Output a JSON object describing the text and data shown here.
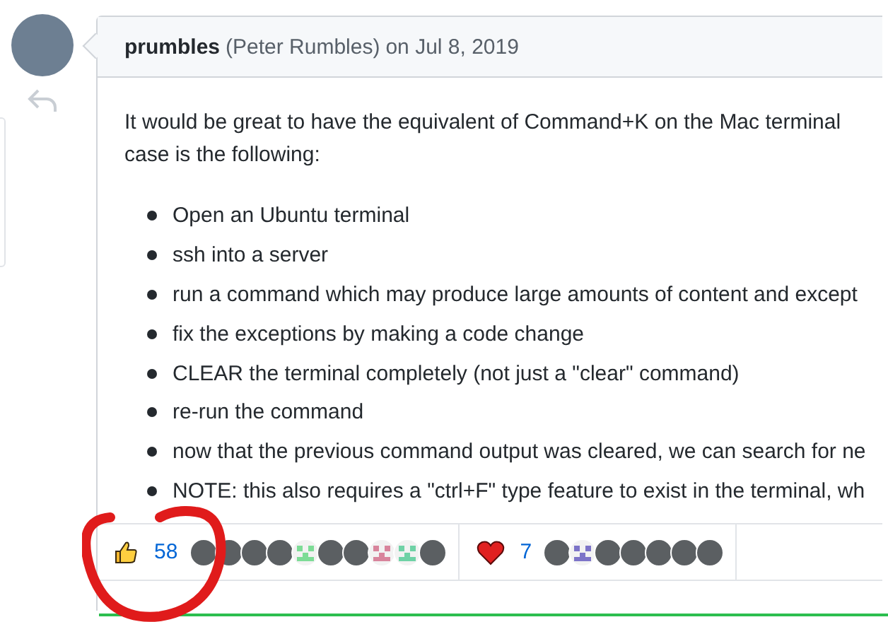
{
  "comment": {
    "author": "prumbles",
    "full_name": "(Peter Rumbles)",
    "date": "on Jul 8, 2019",
    "paragraph": "It would be great to have the equivalent of Command+K on the Mac terminal",
    "paragraph_2": "case is the following:",
    "bullets": [
      "Open an Ubuntu terminal",
      "ssh into a server",
      "run a command which may produce large amounts of content and except",
      "fix the exceptions by making a code change",
      "CLEAR the terminal completely (not just a \"clear\" command)",
      "re-run the command",
      "now that the previous command output was cleared, we can search for ne",
      "NOTE: this also requires a \"ctrl+F\" type feature to exist in the terminal, wh"
    ],
    "reactions": [
      {
        "kind": "thumbs_up",
        "count": "58",
        "avatars": [
          {
            "kind": "photo"
          },
          {
            "kind": "photo"
          },
          {
            "kind": "photo"
          },
          {
            "kind": "photo"
          },
          {
            "kind": "identicon",
            "color": "#7ddc96"
          },
          {
            "kind": "photo"
          },
          {
            "kind": "photo"
          },
          {
            "kind": "identicon",
            "color": "#d8849c"
          },
          {
            "kind": "identicon",
            "color": "#6fd2a6"
          },
          {
            "kind": "photo"
          }
        ]
      },
      {
        "kind": "heart",
        "count": "7",
        "avatars": [
          {
            "kind": "photo"
          },
          {
            "kind": "identicon",
            "color": "#7d74c8"
          },
          {
            "kind": "photo"
          },
          {
            "kind": "photo"
          },
          {
            "kind": "photo"
          },
          {
            "kind": "photo"
          },
          {
            "kind": "photo"
          }
        ]
      }
    ]
  }
}
